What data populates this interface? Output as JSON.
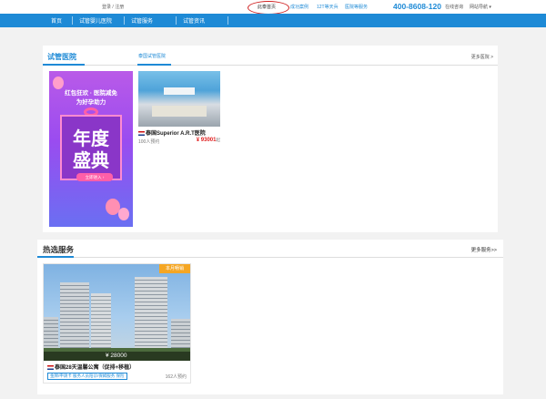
{
  "topbar": {
    "login": "登录",
    "divider": "/",
    "register": "注册",
    "links": [
      "此泰首页",
      "成功案例",
      "12T等天兵",
      "医院等服务"
    ],
    "phone": "400-8608-120",
    "online_consult": "在线咨询",
    "site_nav": "网站导航",
    "active_link_color": "#d02222"
  },
  "nav": {
    "items": [
      "首页",
      "试管婴儿医院",
      "试管服务",
      "试管资讯"
    ],
    "color": "#1e8ad6"
  },
  "hospital_section": {
    "title": "试管医院",
    "subtab": "泰国试管医院",
    "more": "更多医院 >",
    "banner": {
      "line1": "红包狂欢 · 医院减免",
      "line2": "为好孕助力",
      "big1": "年度",
      "big2": "盛典",
      "cta": "立即进入 ›"
    },
    "cards": [
      {
        "name": "泰国Superior A.R.T医院",
        "booked": "100人预约",
        "price": "¥ 93001",
        "price_unit": "起"
      }
    ]
  },
  "services_section": {
    "title": "热选服务",
    "more": "更多服务>>",
    "cards": [
      {
        "tag": "本月畅销",
        "price": "¥ 28000",
        "name": "泰国28天温馨公寓（促排+移植）",
        "features": "金牌/申请卡 服务人员陪诊/保姆服务 保险",
        "booked": "162人预约"
      }
    ]
  }
}
